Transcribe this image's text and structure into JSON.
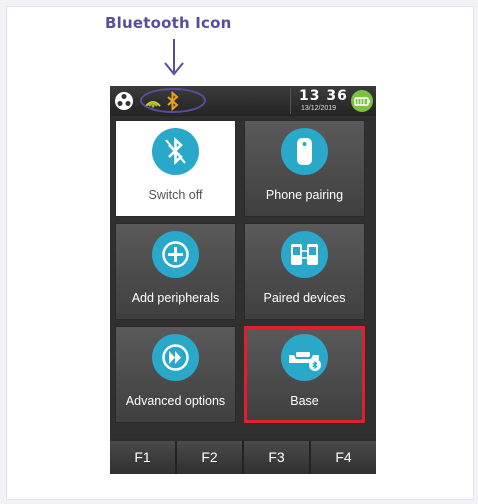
{
  "annotation": {
    "label": "Bluetooth Icon",
    "color": "#5b4c9e"
  },
  "statusbar": {
    "icons": [
      "network-icon",
      "signal-icon",
      "bluetooth-icon",
      "battery-icon"
    ],
    "time": "13 36",
    "date": "13/12/2019"
  },
  "tiles": [
    {
      "label": "Switch off",
      "icon": "bluetooth-off-icon",
      "style": "white"
    },
    {
      "label": "Phone pairing",
      "icon": "phone-icon",
      "style": "dark"
    },
    {
      "label": "Add peripherals",
      "icon": "plus-circle-icon",
      "style": "dark"
    },
    {
      "label": "Paired devices",
      "icon": "paired-devices-icon",
      "style": "dark"
    },
    {
      "label": "Advanced options",
      "icon": "fast-forward-icon",
      "style": "dark"
    },
    {
      "label": "Base",
      "icon": "base-bluetooth-icon",
      "style": "selected"
    }
  ],
  "function_keys": [
    "F1",
    "F2",
    "F3",
    "F4"
  ],
  "colors": {
    "accent_teal": "#29a8c9",
    "selection_red": "#e01f2c",
    "bluetooth_orange": "#f0a020",
    "battery_green": "#7cc242"
  }
}
